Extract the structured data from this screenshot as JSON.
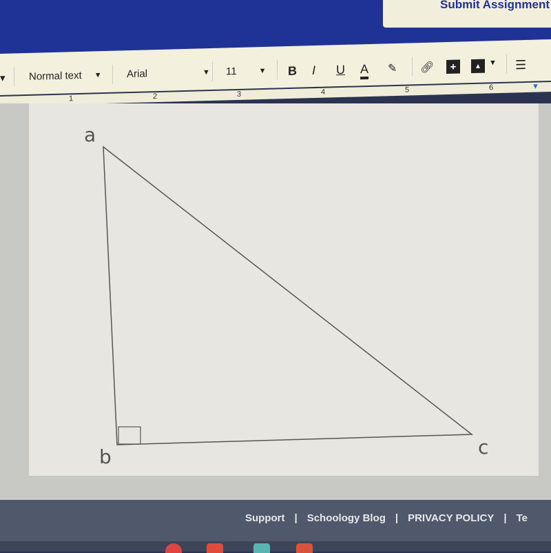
{
  "header": {
    "submit_label": "Submit Assignment"
  },
  "toolbar": {
    "style": "Normal text",
    "font": "Arial",
    "size": "11",
    "bold": "B",
    "italic": "I",
    "underline": "U",
    "text_color": "A"
  },
  "ruler": {
    "marks": [
      "1",
      "2",
      "3",
      "4",
      "5",
      "6"
    ]
  },
  "drawing": {
    "labels": {
      "a": "a",
      "b": "b",
      "c": "c"
    }
  },
  "footer": {
    "links": [
      "Support",
      "Schoology Blog",
      "PRIVACY POLICY",
      "Te"
    ],
    "separator": "|"
  },
  "colors": {
    "header": "#1f3396",
    "footer": "#50586c"
  }
}
